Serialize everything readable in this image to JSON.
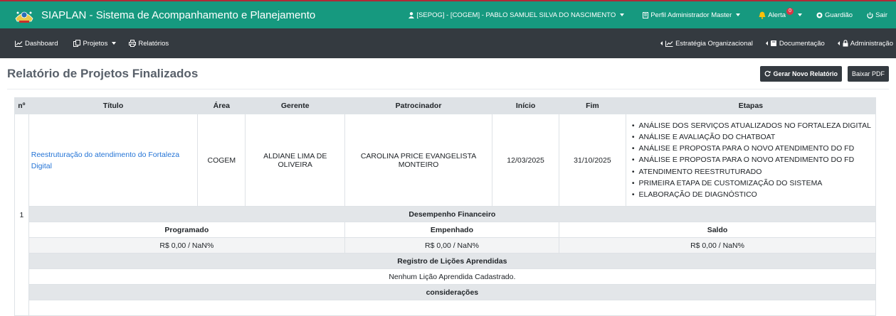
{
  "header": {
    "app_title": "SIAPLAN - Sistema de Acompanhamento e Planejamento",
    "user": "[SEPOG] - [COGEM] - PABLO SAMUEL SILVA DO NASCIMENTO",
    "profile": "Perfil Administrador Master",
    "alert_label": "Alerta",
    "alert_count": "0",
    "guardian": "Guardião",
    "logout": "Sair"
  },
  "nav": {
    "dashboard": "Dashboard",
    "projetos": "Projetos",
    "relatorios": "Relatórios",
    "estrategia": "Estratégia Organizacional",
    "documentacao": "Documentação",
    "administracao": "Administração"
  },
  "page": {
    "title": "Relatório de Projetos Finalizados",
    "new_report_button": "Gerar Novo Relatório",
    "pdf_button": "Baixar PDF"
  },
  "table": {
    "columns": [
      "nº",
      "Título",
      "Área",
      "Gerente",
      "Patrocinador",
      "Início",
      "Fim",
      "Etapas"
    ],
    "row": {
      "num": "1",
      "titulo": "Reestruturação do atendimento do Fortaleza Digital",
      "area": "COGEM",
      "gerente": "ALDIANE LIMA DE OLIVEIRA",
      "patrocinador": "CAROLINA PRICE EVANGELISTA MONTEIRO",
      "inicio": "12/03/2025",
      "fim": "31/10/2025",
      "etapas": [
        "ANÁLISE DOS SERVIÇOS ATUALIZADOS NO FORTALEZA DIGITAL",
        "ANÁLISE E AVALIAÇÃO DO CHATBOAT",
        "ANÁLISE E PROPOSTA PARA O NOVO ATENDIMENTO DO FD",
        "ANÁLISE E PROPOSTA PARA O NOVO ATENDIMENTO DO FD",
        "ATENDIMENTO REESTRUTURADO",
        "PRIMEIRA ETAPA DE CUSTOMIZAÇÃO DO SISTEMA",
        "ELABORAÇÃO DE DIAGNÓSTICO"
      ]
    },
    "financeiro": {
      "heading": "Desempenho Financeiro",
      "programado_label": "Programado",
      "empenhado_label": "Empenhado",
      "saldo_label": "Saldo",
      "programado": "R$ 0,00 / NaN%",
      "empenhado": "R$ 0,00 / NaN%",
      "saldo": "R$ 0,00 / NaN%"
    },
    "licoes": {
      "heading": "Registro de Lições Aprendidas",
      "empty": "Nenhum Lição Aprendida Cadastrado."
    },
    "consideracoes": {
      "heading": "considerações"
    }
  },
  "colors": {
    "topbar": "#16997f",
    "navbar": "#343a40",
    "link": "#2474d6",
    "badge": "#dc3545"
  }
}
